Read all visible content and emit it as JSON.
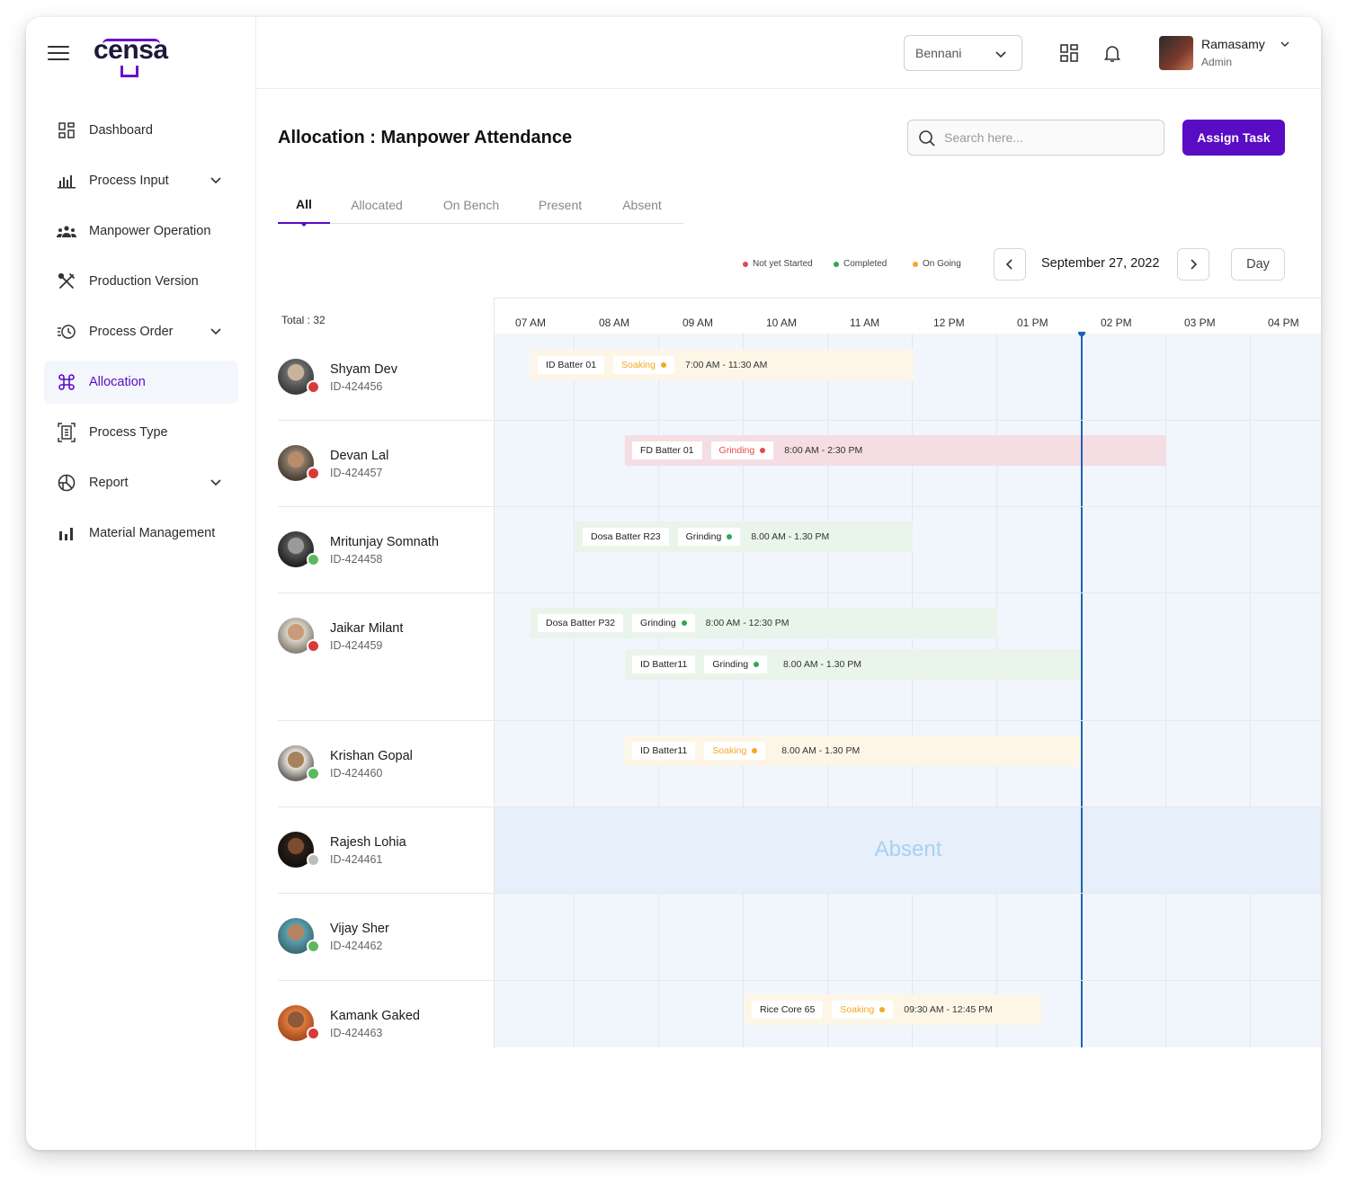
{
  "app": {
    "logo": "censa"
  },
  "sidebar": {
    "items": [
      {
        "label": "Dashboard",
        "icon": "dashboard-icon",
        "chevron": false
      },
      {
        "label": "Process Input",
        "icon": "bar-chart-icon",
        "chevron": true
      },
      {
        "label": "Manpower Operation",
        "icon": "people-icon",
        "chevron": false
      },
      {
        "label": "Production Version",
        "icon": "tools-icon",
        "chevron": false
      },
      {
        "label": "Process Order",
        "icon": "clock-list-icon",
        "chevron": true
      },
      {
        "label": "Allocation",
        "icon": "command-icon",
        "chevron": false,
        "active": true
      },
      {
        "label": "Process Type",
        "icon": "document-scan-icon",
        "chevron": false
      },
      {
        "label": "Report",
        "icon": "pie-report-icon",
        "chevron": true
      },
      {
        "label": "Material Management",
        "icon": "chart-icon",
        "chevron": false
      }
    ]
  },
  "header": {
    "location": "Bennani",
    "user": {
      "name": "Ramasamy",
      "role": "Admin"
    }
  },
  "page": {
    "title": "Allocation : Manpower Attendance",
    "search_placeholder": "Search here...",
    "assign_label": "Assign Task",
    "tabs": [
      "All",
      "Allocated",
      "On Bench",
      "Present",
      "Absent"
    ],
    "active_tab": "All",
    "legend": [
      {
        "label": "Not yet Started",
        "color": "#e5484d"
      },
      {
        "label": "Completed",
        "color": "#2fa84f"
      },
      {
        "label": "On Going",
        "color": "#f5a623"
      }
    ],
    "date": "September 27, 2022",
    "view": "Day",
    "total": "Total : 32",
    "hours": [
      "07 AM",
      "08 AM",
      "09 AM",
      "10 AM",
      "11 AM",
      "12 PM",
      "01 PM",
      "02 PM",
      "03 PM",
      "04 PM"
    ],
    "absent_label": "Absent"
  },
  "people": [
    {
      "name": "Shyam Dev",
      "id": "ID-424456",
      "status_color": "#d83a3a"
    },
    {
      "name": "Devan Lal",
      "id": "ID-424457",
      "status_color": "#d83a3a"
    },
    {
      "name": "Mritunjay Somnath",
      "id": "ID-424458",
      "status_color": "#5cb85c"
    },
    {
      "name": "Jaikar Milant",
      "id": "ID-424459",
      "status_color": "#d83a3a"
    },
    {
      "name": "Krishan Gopal",
      "id": "ID-424460",
      "status_color": "#5cb85c"
    },
    {
      "name": "Rajesh Lohia",
      "id": "ID-424461",
      "status_color": "#bdbdbd"
    },
    {
      "name": "Vijay Sher",
      "id": "ID-424462",
      "status_color": "#5cb85c"
    },
    {
      "name": "Kamank Gaked",
      "id": "ID-424463",
      "status_color": "#d83a3a"
    }
  ],
  "tasks": [
    {
      "batch": "ID Batter 01",
      "process": "Soaking",
      "process_color": "#f5a623",
      "dot": "#f5a623",
      "time": "7:00 AM - 11:30 AM",
      "bg": "#fdf6e7"
    },
    {
      "batch": "FD Batter 01",
      "process": "Grinding",
      "process_color": "#e5484d",
      "dot": "#e5484d",
      "time": "8:00 AM - 2:30 PM",
      "bg": "#f4dde3"
    },
    {
      "batch": "Dosa Batter R23",
      "process": "Grinding",
      "process_color": "#222222",
      "dot": "#2fa84f",
      "time": "8.00 AM - 1.30  PM",
      "bg": "#e9f4ea"
    },
    {
      "batch": "Dosa Batter P32",
      "process": "Grinding",
      "process_color": "#222222",
      "dot": "#2fa84f",
      "time": "8:00 AM - 12:30 PM",
      "bg": "#e9f4ea"
    },
    {
      "batch": "ID Batter11",
      "process": "Grinding",
      "process_color": "#222222",
      "dot": "#2fa84f",
      "time": "8.00 AM - 1.30  PM",
      "bg": "#e9f4ea"
    },
    {
      "batch": "ID Batter11",
      "process": "Soaking",
      "process_color": "#f5a623",
      "dot": "#f5a623",
      "time": "8.00 AM - 1.30  PM",
      "bg": "#fdf6e7"
    },
    {
      "batch": "Rice Core 65",
      "process": "Soaking",
      "process_color": "#f5a623",
      "dot": "#f5a623",
      "time": "09:30 AM - 12:45 PM",
      "bg": "#fdf6e7"
    }
  ]
}
